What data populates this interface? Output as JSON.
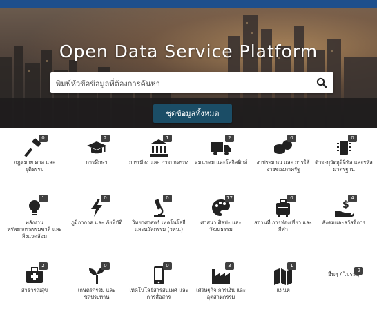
{
  "hero": {
    "title": "Open Data Service Platform",
    "search_placeholder": "พิมพ์หัวข้อข้อมูลที่ต้องการค้นหา",
    "all_datasets_label": "ชุดข้อมูลทั้งหมด"
  },
  "colors": {
    "topbar": "#1e4f8c",
    "button": "#1b4d66",
    "badge": "#404040",
    "icon": "#222222"
  },
  "categories": [
    {
      "label": "กฎหมาย ศาล และยุติธรรม",
      "count": "0",
      "icon": "gavel-icon"
    },
    {
      "label": "การศึกษา",
      "count": "2",
      "icon": "graduation-cap-icon"
    },
    {
      "label": "การเมือง และ การปกครอง",
      "count": "1",
      "icon": "government-building-icon"
    },
    {
      "label": "คมนาคม และโลจิสติกส์",
      "count": "2",
      "icon": "truck-icon"
    },
    {
      "label": "งบประมาณ และ การใช้จ่ายของภาครัฐ",
      "count": "0",
      "icon": "coins-icon"
    },
    {
      "label": "ตัวระบุวัตถุดิจิทัล และรหัสมาตรฐาน",
      "count": "0",
      "icon": "microchip-icon"
    },
    {
      "label": "พลังงาน ทรัพยากรธรรมชาติ และสิ่งแวดล้อม",
      "count": "1",
      "icon": "lightbulb-icon"
    },
    {
      "label": "ภูมิอากาศ และ ภัยพิบัติ",
      "count": "0",
      "icon": "lightning-icon"
    },
    {
      "label": "วิทยาศาสตร์ เทคโนโลยี และนวัตกรรม (วทน.)",
      "count": "0",
      "icon": "microscope-icon"
    },
    {
      "label": "ศาสนา ศิลปะ และวัฒนธรรม",
      "count": "17",
      "icon": "palette-icon"
    },
    {
      "label": "สถานที่ การท่องเที่ยว และกีฬา",
      "count": "0",
      "icon": "luggage-icon"
    },
    {
      "label": "สังคมและสวัสดิการ",
      "count": "4",
      "icon": "hand-money-icon"
    },
    {
      "label": "สาธารณสุข",
      "count": "2",
      "icon": "first-aid-kit-icon"
    },
    {
      "label": "เกษตรกรรม และชลประทาน",
      "count": "0",
      "icon": "seedling-icon"
    },
    {
      "label": "เทคโนโลยีสารสนเทศ และการสื่อสาร",
      "count": "0",
      "icon": "mobile-phone-icon"
    },
    {
      "label": "เศรษฐกิจ การเงิน และอุตสาหกรรม",
      "count": "3",
      "icon": "industry-icon"
    },
    {
      "label": "แผนที่",
      "count": "1",
      "icon": "map-icon"
    }
  ],
  "more": {
    "label": "อื่นๆ / ไม่ระบุ",
    "count": "2"
  }
}
